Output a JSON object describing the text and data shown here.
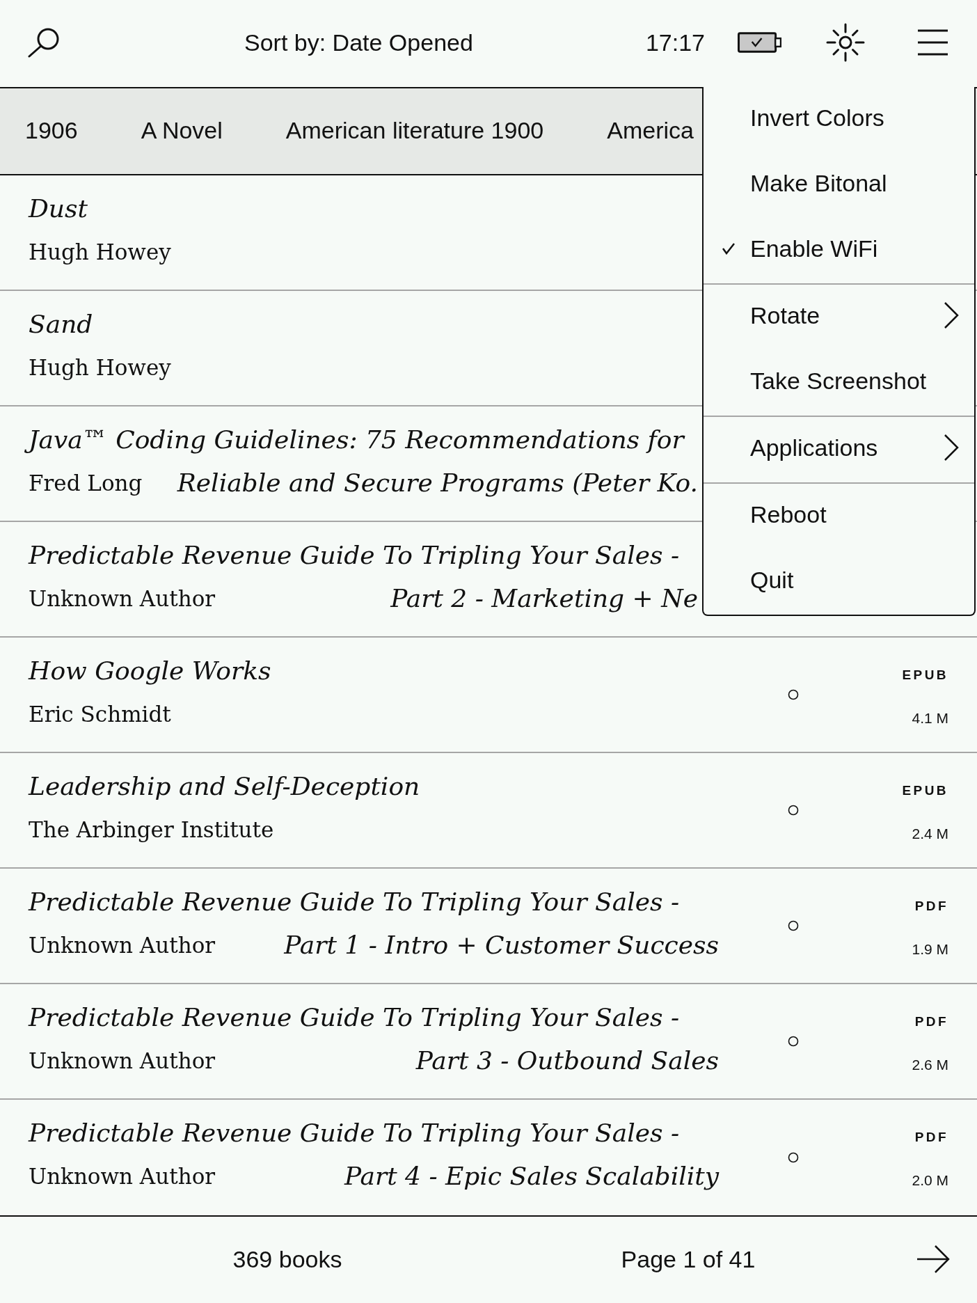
{
  "top_bar": {
    "sort_label": "Sort by: Date Opened",
    "time": "17:17"
  },
  "tags": [
    "1906",
    "A Novel",
    "American literature 1900",
    "America"
  ],
  "books": [
    {
      "title_lines": [
        "Dust"
      ],
      "author": "Hugh Howey"
    },
    {
      "title_lines": [
        "Sand"
      ],
      "author": "Hugh Howey"
    },
    {
      "title_lines": [
        "Java™ Coding Guidelines: 75 Recommendations for",
        "Reliable and Secure Programs (Peter Ko."
      ],
      "author": "Fred Long"
    },
    {
      "title_lines": [
        "Predictable Revenue Guide To Tripling Your Sales -",
        "Part 2 - Marketing + Ne"
      ],
      "author": "Unknown Author"
    },
    {
      "title_lines": [
        "How Google Works"
      ],
      "author": "Eric Schmidt",
      "format": "EPUB",
      "size": "4.1 M"
    },
    {
      "title_lines": [
        "Leadership and Self-Deception"
      ],
      "author": "The Arbinger Institute",
      "format": "EPUB",
      "size": "2.4 M"
    },
    {
      "title_lines": [
        "Predictable Revenue Guide To Tripling Your Sales -",
        "Part 1 - Intro + Customer Success"
      ],
      "author": "Unknown Author",
      "format": "PDF",
      "size": "1.9 M"
    },
    {
      "title_lines": [
        "Predictable Revenue Guide To Tripling Your Sales -",
        "Part 3 - Outbound Sales"
      ],
      "author": "Unknown Author",
      "format": "PDF",
      "size": "2.6 M"
    },
    {
      "title_lines": [
        "Predictable Revenue Guide To Tripling Your Sales -",
        "Part 4 - Epic Sales Scalability"
      ],
      "author": "Unknown Author",
      "format": "PDF",
      "size": "2.0 M"
    }
  ],
  "menu": {
    "groups": [
      {
        "items": [
          {
            "label": "Invert Colors",
            "checked": false,
            "submenu": false
          },
          {
            "label": "Make Bitonal",
            "checked": false,
            "submenu": false
          },
          {
            "label": "Enable WiFi",
            "checked": true,
            "submenu": false
          }
        ]
      },
      {
        "items": [
          {
            "label": "Rotate",
            "checked": false,
            "submenu": true
          },
          {
            "label": "Take Screenshot",
            "checked": false,
            "submenu": false
          }
        ]
      },
      {
        "items": [
          {
            "label": "Applications",
            "checked": false,
            "submenu": true
          }
        ]
      },
      {
        "items": [
          {
            "label": "Reboot",
            "checked": false,
            "submenu": false
          },
          {
            "label": "Quit",
            "checked": false,
            "submenu": false
          }
        ]
      }
    ]
  },
  "footer": {
    "book_count": "369 books",
    "page": "Page 1 of 41"
  }
}
